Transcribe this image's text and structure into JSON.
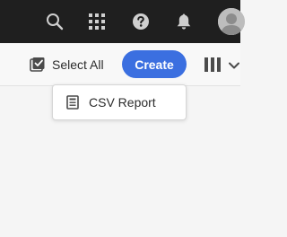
{
  "topbar": {
    "icons": [
      "search-icon",
      "apps-grid-icon",
      "help-icon",
      "bell-icon",
      "user-avatar"
    ]
  },
  "actionbar": {
    "select_all_label": "Select All",
    "create_label": "Create",
    "view_icon": "column-view-icon",
    "chevron_icon": "chevron-down-icon"
  },
  "create_menu": {
    "items": [
      {
        "label": "CSV Report",
        "icon": "report-icon"
      }
    ]
  },
  "colors": {
    "topbar_bg": "#1f1f1f",
    "accent": "#3b6fe0",
    "background": "#f5f5f5"
  }
}
